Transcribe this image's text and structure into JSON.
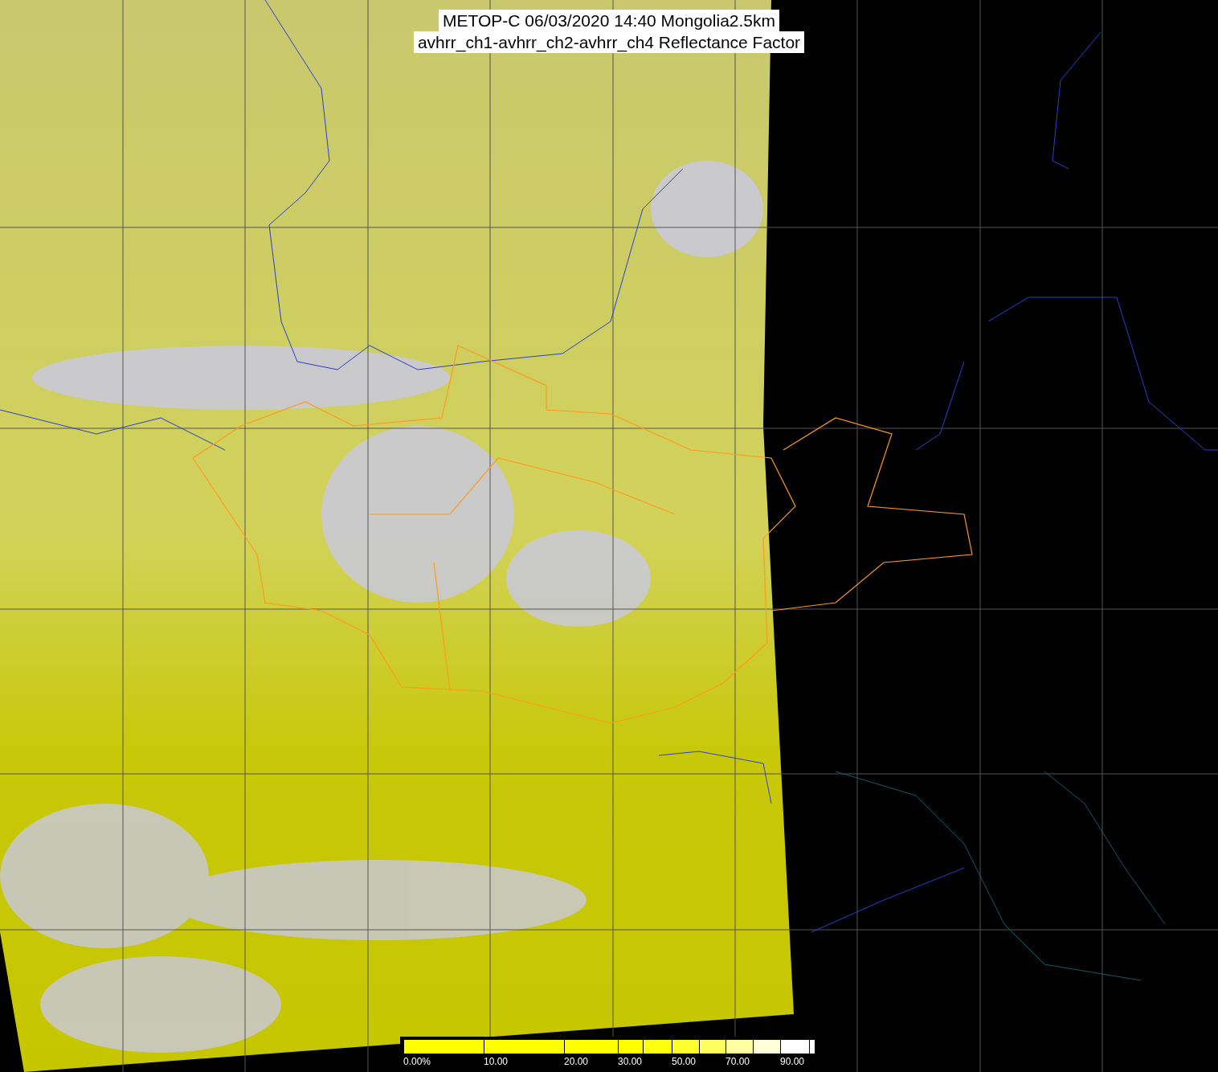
{
  "title": {
    "lines": [
      "METOP-C 06/03/2020 14:40 Mongolia2.5km",
      "avhrr_ch1-avhrr_ch2-avhrr_ch4 Reflectance Factor"
    ]
  },
  "legend": {
    "segments": [
      {
        "color": "#ffff00",
        "label": "0.00%"
      },
      {
        "color": "#ffff00",
        "label": "10.00"
      },
      {
        "color": "#ffff00",
        "label": "20.00"
      },
      {
        "color": "#ffff00",
        "label": "30.00"
      },
      {
        "color": "#ffff10"
      },
      {
        "color": "#ffff30",
        "label": "50.00"
      },
      {
        "color": "#ffff60"
      },
      {
        "color": "#ffffa0",
        "label": "70.00"
      },
      {
        "color": "#ffffd8"
      },
      {
        "color": "#ffffff",
        "label": "90.00"
      },
      {
        "color": "#ffffff"
      }
    ]
  }
}
